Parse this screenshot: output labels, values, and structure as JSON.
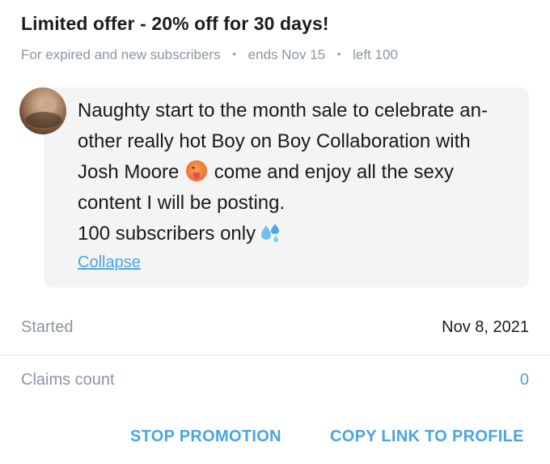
{
  "promo": {
    "title": "Limited offer - 20% off for 30 days!",
    "audience": "For expired and new subscribers",
    "ends": "ends Nov 15",
    "left": "left 100",
    "separator": "•"
  },
  "message": {
    "line1": "Naughty start to the month sale to celebrate an-",
    "line2": "other really hot Boy on Boy Collaboration with",
    "line3_a": "Josh Moore",
    "line3_b": "come and enjoy all the sexy",
    "line4": "content I will be posting.",
    "line5": "100 subscribers only",
    "collapse_label": "Collapse",
    "emojis": [
      "hot-face-emoji",
      "sweat-droplets-emoji"
    ]
  },
  "details": {
    "started_label": "Started",
    "started_value": "Nov 8, 2021",
    "claims_label": "Claims count",
    "claims_value": "0"
  },
  "actions": {
    "stop_label": "STOP PROMOTION",
    "copy_label": "COPY LINK TO PROFILE"
  },
  "colors": {
    "accent": "#4aa5e0",
    "muted": "#8a96a3",
    "bubble": "#f4f4f4"
  }
}
